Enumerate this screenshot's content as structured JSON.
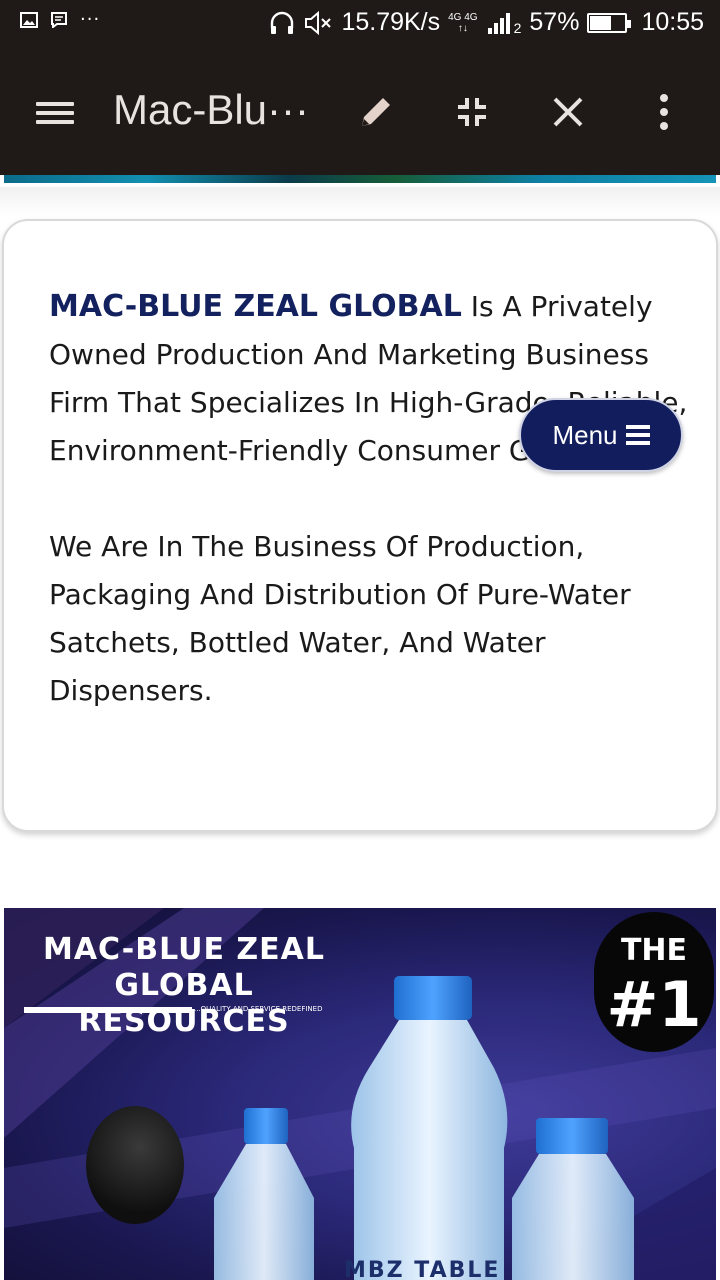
{
  "status_bar": {
    "network_speed": "15.79K/s",
    "network_type_top": "4G 4G",
    "sim_slot": "2",
    "battery_percent_text": "57%",
    "battery_level": 0.57,
    "time": "10:55",
    "left_icons": [
      "image-icon",
      "message-icon",
      "more-dots-icon"
    ],
    "more_dots": "···"
  },
  "toolbar": {
    "title": "Mac-Blu···",
    "icons": [
      "hamburger-icon",
      "pencil-icon",
      "shrink-icon",
      "close-icon",
      "kebab-icon"
    ]
  },
  "about": {
    "brand": "MAC-BLUE ZEAL GLOBAL",
    "paragraph1_rest": " Is A Privately Owned Production And Marketing Business Firm That Specializes In High-Grade, Reliable, Environment-Friendly Consumer Goods",
    "paragraph2": "We Are In The Business Of Production, Packaging And Distribution Of Pure-Water Satchets, Bottled Water, And Water Dispensers."
  },
  "menu_button": {
    "label": "Menu",
    "icon": "hamburger-icon",
    "color": "#121d5e"
  },
  "banner": {
    "title_line1": "MAC-BLUE ZEAL",
    "title_line2": "GLOBAL RESOURCES",
    "tagline": "...QUALITY AND SERVICE REDEFINED",
    "badge_line1": "THE",
    "badge_line2": "#1",
    "bottle_label": "MBZ TABLE"
  }
}
